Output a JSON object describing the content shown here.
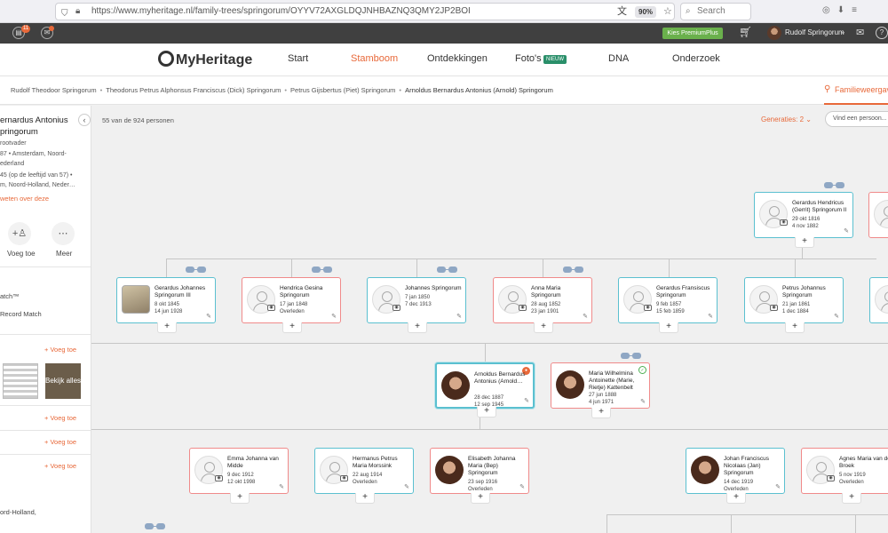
{
  "browser": {
    "url": "https://www.myheritage.nl/family-trees/springorum/OYYV72AXGLDQJNHBAZNQ3QMY2JP2BOI",
    "zoom": "90%",
    "search_placeholder": "Search"
  },
  "toolbar": {
    "badge1": "11",
    "premium_label": "Kies PremiumPlus",
    "user_name": "Rudolf Springorum"
  },
  "nav": {
    "logo": "MyHeritage",
    "items": [
      "Start",
      "Stamboom",
      "Ontdekkingen",
      "Foto's",
      "DNA",
      "Onderzoek"
    ],
    "new_badge": "NIEUW"
  },
  "breadcrumb": {
    "items": [
      "Rudolf Theodoor Springorum",
      "Theodorus Petrus Alphonsus Franciscus (Dick) Springorum",
      "Petrus Gijsbertus (Piet) Springorum",
      "Arnoldus Bernardus Antonius (Arnold) Springorum"
    ],
    "tab_label": "Familieweergave"
  },
  "left_panel": {
    "name_line1": "ernardus Antonius",
    "name_line2": "pringorum",
    "relation": "rootvader",
    "birth": "87 • Amsterdam, Noord-",
    "birth2": "ederland",
    "death": "45 (op de leeftijd van 57) •",
    "death2": "m, Noord-Holland, Neder…",
    "more_link": "weten over deze",
    "add_label": "Voeg toe",
    "more_label": "Meer",
    "match": "atch™",
    "record_match": "Record Match",
    "add_link": "+ Voeg toe",
    "see_all": "Bekijk alles",
    "add_link2": "+ Voeg toe",
    "add_link3": "+ Voeg toe",
    "add_link4": "+ Voeg toe",
    "place": "ord-Holland,"
  },
  "tree": {
    "count": "55 van de 924 personen",
    "generations_label": "Generaties: 2",
    "find_placeholder": "Vind een persoon...",
    "top_person": {
      "name": "Gerardus Hendricus (Gerrit) Springorum II",
      "birth": "29 okt 1816",
      "death": "4 nov 1882"
    },
    "siblings": [
      {
        "name": "Gerardus Johannes Springorum III",
        "birth": "8 okt 1845",
        "death": "14 jun 1928"
      },
      {
        "name": "Hendrica Gesina Springorum",
        "birth": "17 jan 1848",
        "death": "Overleden"
      },
      {
        "name": "Johannes Springorum",
        "birth": "7 jan 1850",
        "death": "7 dec 1913"
      },
      {
        "name": "Anna Maria Springorum",
        "birth": "28 aug 1852",
        "death": "23 jan 1901"
      },
      {
        "name": "Gerardus Fransiscus Springorum",
        "birth": "9 feb 1857",
        "death": "15 feb 1859"
      },
      {
        "name": "Petrus Johannus Springorum",
        "birth": "21 jan 1861",
        "death": "1 dec 1884"
      }
    ],
    "focus": {
      "name": "Arnoldus Bernardus Antonius (Arnold…",
      "birth": "28 dec 1887",
      "death": "12 sep 1945"
    },
    "spouse": {
      "name": "Maria Wilhelmina Antoinette (Marie, Rietje) Kattenbelt",
      "birth": "27 jun 1888",
      "death": "4 jun 1971"
    },
    "children": [
      {
        "name": "Emma Johanna van Midde",
        "birth": "9 dec 1912",
        "death": "12 okt 1998"
      },
      {
        "name": "Hermanus Petrus Maria Morssink",
        "birth": "22 aug 1914",
        "death": "Overleden"
      },
      {
        "name": "Elisabeth Johanna Maria (Bep) Springorum",
        "birth": "23 sep 1916",
        "death": "Overleden"
      },
      {
        "name": "Johan Franciscus Nicolaas (Jan) Springorum",
        "birth": "14 dec 1919",
        "death": "Overleden"
      },
      {
        "name": "Agnes Maria van de Broek",
        "birth": "5 nov 1919",
        "death": "Overleden"
      }
    ]
  }
}
